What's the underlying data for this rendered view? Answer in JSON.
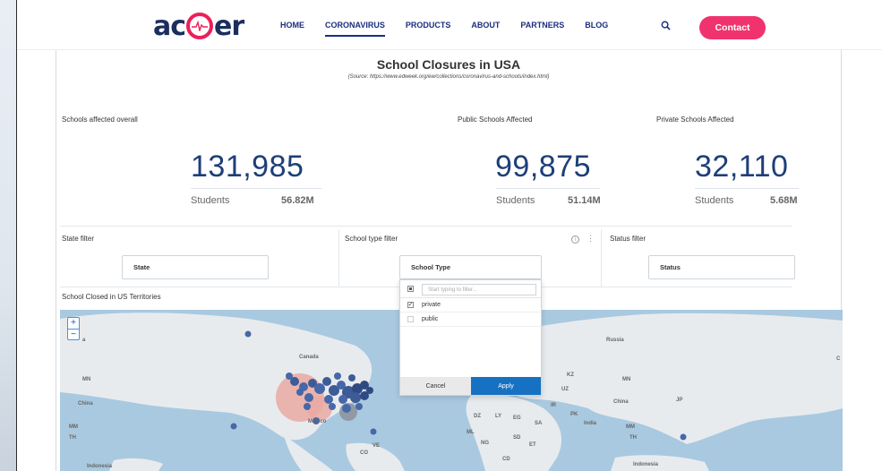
{
  "nav": {
    "logo_left": "ac",
    "logo_right": "er",
    "links": [
      {
        "label": "HOME",
        "active": false
      },
      {
        "label": "CORONAVIRUS",
        "active": true
      },
      {
        "label": "PRODUCTS",
        "active": false
      },
      {
        "label": "ABOUT",
        "active": false
      },
      {
        "label": "PARTNERS",
        "active": false
      },
      {
        "label": "BLOG",
        "active": false
      }
    ],
    "contact_label": "Contact",
    "accent_color": "#f0336f",
    "link_color": "#1b2e7e"
  },
  "dashboard": {
    "title": "School Closures in USA",
    "source": "(Source: https://www.edweek.org/ew/collections/coronavirus-and-schools/index.html)",
    "kpis": [
      {
        "label": "Schools affected overall",
        "value": "131,985",
        "students_label": "Students",
        "students_value": "56.82M"
      },
      {
        "label": "Public Schools Affected",
        "value": "99,875",
        "students_label": "Students",
        "students_value": "51.14M"
      },
      {
        "label": "Private Schools Affected",
        "value": "32,110",
        "students_label": "Students",
        "students_value": "5.68M"
      }
    ],
    "filters": [
      {
        "label": "State filter",
        "value": "State"
      },
      {
        "label": "School type filter",
        "value": "School Type"
      },
      {
        "label": "Status filter",
        "value": "Status"
      }
    ],
    "dropdown": {
      "placeholder": "Start typing to filter...",
      "options": [
        {
          "label": "private",
          "checked": true
        },
        {
          "label": "public",
          "checked": false
        }
      ],
      "cancel_label": "Cancel",
      "apply_label": "Apply"
    },
    "map": {
      "title": "School Closed in US Territories",
      "labels": [
        "Canada",
        "Russia",
        "China",
        "China",
        "India",
        "Mexico",
        "Indonesia",
        "Indonesia",
        "MN",
        "MN",
        "KZ",
        "UZ",
        "IR",
        "PK",
        "DZ",
        "LY",
        "EG",
        "SA",
        "ML",
        "NG",
        "SD",
        "ET",
        "CD",
        "VE",
        "CO",
        "MM",
        "TH",
        "JP",
        "C",
        "MM",
        "TH",
        "a"
      ],
      "zoom_in": "+",
      "zoom_out": "−"
    }
  }
}
